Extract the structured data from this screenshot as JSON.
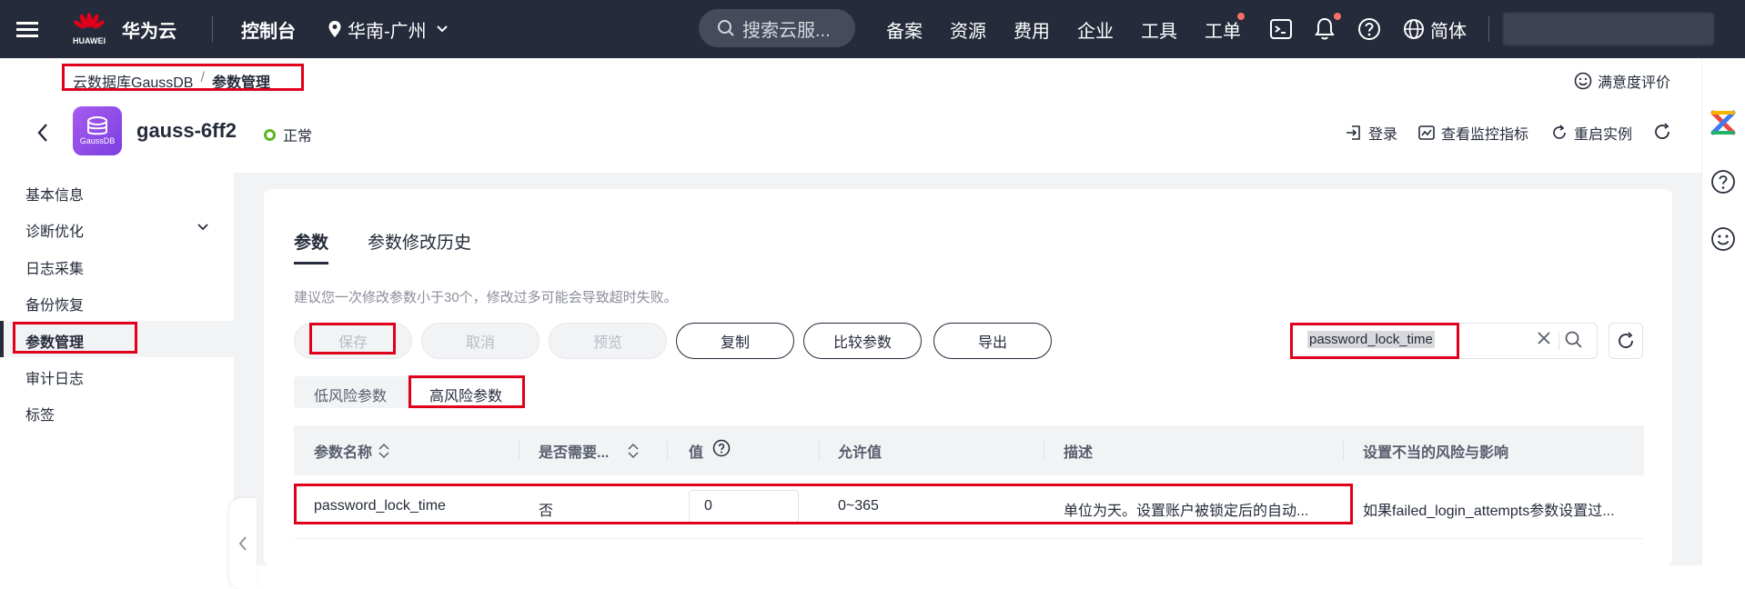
{
  "topbar": {
    "brand_caption": "HUAWEI",
    "brand": "华为云",
    "console": "控制台",
    "region": "华南-广州",
    "search_placeholder": "搜索云服...",
    "nav": [
      "备案",
      "资源",
      "费用",
      "企业",
      "工具",
      "工单"
    ],
    "lang": "简体"
  },
  "breadcrumb": {
    "parent": "云数据库GaussDB",
    "sep": "/",
    "current": "参数管理"
  },
  "satisfaction": "满意度评价",
  "instance": {
    "icon_caption": "GaussDB",
    "name": "gauss-6ff2",
    "status": "正常",
    "actions": [
      "登录",
      "查看监控指标",
      "重启实例"
    ]
  },
  "sidebar": {
    "items": [
      "基本信息",
      "诊断优化",
      "日志采集",
      "备份恢复",
      "参数管理",
      "审计日志",
      "标签"
    ]
  },
  "tabs": [
    "参数",
    "参数修改历史"
  ],
  "hint": "建议您一次修改参数小于30个，修改过多可能会导致超时失败。",
  "toolbar": {
    "buttons": [
      "保存",
      "取消",
      "预览",
      "复制",
      "比较参数",
      "导出"
    ],
    "search_value": "password_lock_time"
  },
  "segments": [
    "低风险参数",
    "高风险参数"
  ],
  "table": {
    "headers": [
      "参数名称",
      "是否需要...",
      "值",
      "允许值",
      "描述",
      "设置不当的风险与影响"
    ],
    "rows": [
      {
        "name": "password_lock_time",
        "restart": "否",
        "value": "0",
        "allowed": "0~365",
        "desc": "单位为天。设置账户被锁定后的自动...",
        "risk": "如果failed_login_attempts参数设置过..."
      }
    ]
  },
  "colors": {
    "topbar": "#252b3a",
    "highlight": "#e0001b",
    "status_ok": "#5eb626"
  }
}
